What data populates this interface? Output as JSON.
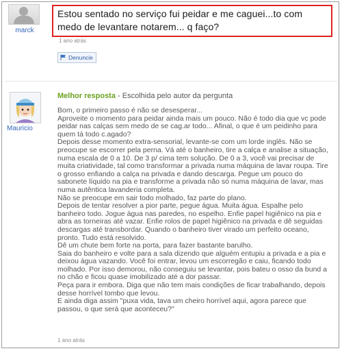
{
  "question": {
    "username": "marck",
    "text": "Estou sentado no serviço fui peidar e me caguei...to com medo de levantare notarem... q faço?",
    "time": "1 ano atrás",
    "report_label": "Denuncie"
  },
  "answer": {
    "username": "Mauricio",
    "best_label": "Melhor resposta",
    "best_sub": " - Escolhida pelo autor da pergunta",
    "lines": [
      "Bom, o primeiro passo é não se desesperar...",
      "Aproveite o momento para peidar ainda mais um pouco. Não é todo dia que vc pode peidar nas calças sem medo de se cag.ar todo... Afinal, o que é um peidinho para quem tá todo c.agado?",
      "Depois desse momento extra-sensorial, levante-se com um lorde inglês. Não se preocupe se escorrer pela perna. Vá até o banheiro, tire a calça e analise a situação, numa escala de 0 a 10. De 3 p/ cima tem solução. De 0 a 3, você vai precisar de muita criatividade, tal como transformar a privada numa máquina de lavar roupa. Tire o grosso enfiando a calça na privada e dando descarga. Pegue um pouco do sabonete líquido na pia e transforme a privada não só numa máquina de lavar, mas numa autêntica lavanderia completa.",
      "Não se preocupe em sair todo molhado, faz parte do plano.",
      "Depois de tentar resolver a pior parte, pegue água. Muita água. Espalhe pelo banheiro todo. Jogue água nas paredes, no espelho. Enfie papel higiênico na pia e abra as torneiras até vazar. Enfie rolos de papel higiênico na privada e dê seguidas descargas até transbordar. Quando o banheiro tiver virado um perfeito oceano, pronto. Tudo está resolvido.",
      "Dê um chute bem forte na porta, para fazer bastante barulho.",
      "Saia do banheiro e volte para a sala dizendo que alguém entupiu a privada e a pia e deixou água vazando. Você foi entrar, levou um escorregão e caiu, ficando todo molhado. Por isso demorou, não conseguiu se levantar, pois bateu o osso da bund a no chão e ficou quase imobilizado até a dor passar.",
      "Peça para ir embora. Diga que não tem mais condições de ficar trabalhando, depois desse horrível tombo que levou.",
      "E ainda diga assim \"puxa vida, tava um cheiro horrível aqui, agora parece que passou, o que será que aconteceu?\""
    ],
    "time": "1 ano atrás"
  },
  "colors": {
    "question_border": "#e02020",
    "best_label": "#6aa21f",
    "username_link": "#3366bb"
  },
  "icons": {
    "question_avatar": "default-user-avatar",
    "answer_avatar": "cartoon-avatar-cap",
    "report": "flag-icon"
  }
}
